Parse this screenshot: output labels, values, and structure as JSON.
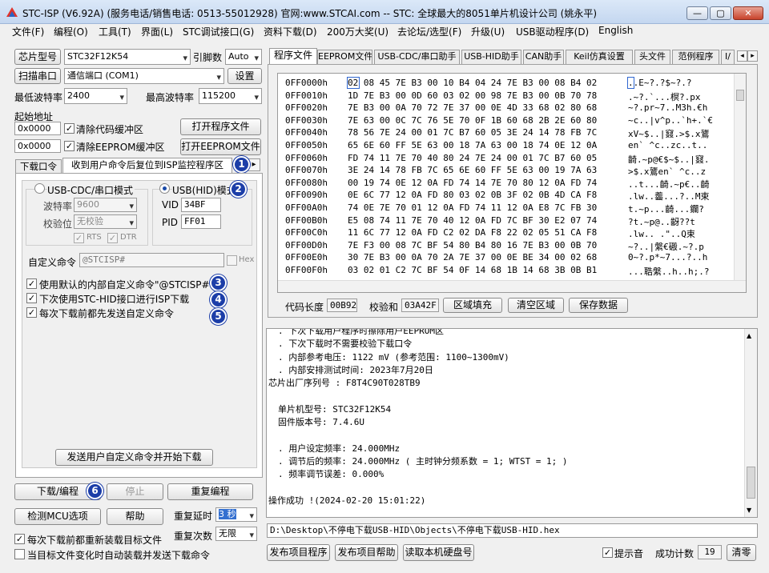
{
  "window": {
    "title": "STC-ISP (V6.92A) (服务电话/销售电话: 0513-55012928) 官网:www.STCAI.com  -- STC: 全球最大的8051单片机设计公司 (姚永平)",
    "min_label": "—",
    "max_label": "▢",
    "close_label": "✕"
  },
  "menu": [
    "文件(F)",
    "编程(O)",
    "工具(T)",
    "界面(L)",
    "STC调试接口(G)",
    "资料下载(D)",
    "200万大奖(U)",
    "去论坛/选型(F)",
    "升级(U)",
    "USB驱动程序(D)",
    "English"
  ],
  "left": {
    "chip_btn": "芯片型号",
    "chip_value": "STC32F12K54",
    "pin_label": "引脚数",
    "pin_value": "Auto",
    "scan_btn": "扫描串口",
    "port_value": "通信端口 (COM1)",
    "settings_btn": "设置",
    "min_baud_label": "最低波特率",
    "min_baud_value": "2400",
    "max_baud_label": "最高波特率",
    "max_baud_value": "115200",
    "start_addr_label": "起始地址",
    "addr1": "0x0000",
    "clear_code_label": "清除代码缓冲区",
    "open_prog_btn": "打开程序文件",
    "addr2": "0x0000",
    "clear_eeprom_label": "清除EEPROM缓冲区",
    "open_eeprom_btn": "打开EEPROM文件",
    "tab_download": "下载口令",
    "tab_reset": "收到用户命令后复位到ISP监控程序区",
    "usb_cdc_label": "USB-CDC/串口模式",
    "usb_hid_label": "USB(HID)模式",
    "baud_label": "波特率",
    "baud_value": "9600",
    "parity_label": "校验位",
    "parity_value": "无校验",
    "rts_label": "RTS",
    "dtr_label": "DTR",
    "vid_label": "VID",
    "vid_value": "34BF",
    "pid_label": "PID",
    "pid_value": "FF01",
    "custom_cmd_label": "自定义命令",
    "custom_cmd_value": "@STCISP#",
    "hex_label": "Hex",
    "opt1": "使用默认的内部自定义命令\"@STCISP#\"",
    "opt2": "下次使用STC-HID接口进行ISP下载",
    "opt3": "每次下载前都先发送自定义命令",
    "send_btn": "发送用户自定义命令并开始下载",
    "download_btn": "下载/编程",
    "stop_btn": "停止",
    "reprogram_btn": "重复编程",
    "detect_btn": "检测MCU选项",
    "help_btn": "帮助",
    "repeat_delay_label": "重复延时",
    "repeat_delay_value": "3 秒",
    "repeat_count_label": "重复次数",
    "repeat_count_value": "无限",
    "reload_label": "每次下载前都重新装载目标文件",
    "auto_label": "当目标文件变化时自动装载并发送下载命令",
    "badges": [
      "1",
      "2",
      "3",
      "4",
      "5",
      "6"
    ]
  },
  "right": {
    "tabs": [
      "程序文件",
      "EEPROM文件",
      "USB-CDC/串口助手",
      "USB-HID助手",
      "CAN助手",
      "Keil仿真设置",
      "头文件",
      "范例程序",
      "I/"
    ],
    "hex_rows": [
      {
        "addr": "0FF0000h",
        "bytes": "02 08 45 7E B3 00 10 B4 04 24 7E B3 00 08 B4 02",
        "ascii": "..E~?.?$~?.?"
      },
      {
        "addr": "0FF0010h",
        "bytes": "1D 7E B3 00 0D 60 03 02 00 98 7E B3 00 0B 70 78",
        "ascii": ".~?.`...榠?.px"
      },
      {
        "addr": "0FF0020h",
        "bytes": "7E B3 00 0A 70 72 7E 37 00 0E 4D 33 68 02 80 68",
        "ascii": "~?.pr~7..M3h.€h"
      },
      {
        "addr": "0FF0030h",
        "bytes": "7E 63 00 0C 7C 76 5E 70 0F 1B 60 68 2B 2E 60 80",
        "ascii": "~c..|v^p..`h+.`€"
      },
      {
        "addr": "0FF0040h",
        "bytes": "78 56 7E 24 00 01 7C B7 60 05 3E 24 14 78 FB 7C",
        "ascii": "xV~$..|窡.>$.x鷟"
      },
      {
        "addr": "0FF0050h",
        "bytes": "65 6E 60 FF 5E 63 00 18 7A 63 00 18 74 0E 12 0A",
        "ascii": "en` ^c..zc..t.."
      },
      {
        "addr": "0FF0060h",
        "bytes": "FD 74 11 7E 70 40 80 24 7E 24 00 01 7C B7 60 05",
        "ascii": "齮.~p@€$~$..|窡."
      },
      {
        "addr": "0FF0070h",
        "bytes": "3E 24 14 78 FB 7C 65 6E 60 FF 5E 63 00 19 7A 63",
        "ascii": ">$.x鷟en` ^c..z"
      },
      {
        "addr": "0FF0080h",
        "bytes": "00 19 74 0E 12 0A FD 74 14 7E 70 80 12 0A FD 74",
        "ascii": "..t...齮.~p€..齮"
      },
      {
        "addr": "0FF0090h",
        "bytes": "0E 6C 77 12 0A FD 80 03 02 0B 3F 02 0B 4D CA F8",
        "ascii": ".lw..齹...?..M束"
      },
      {
        "addr": "0FF00A0h",
        "bytes": "74 0E 7E 70 01 12 0A FD 74 11 12 0A E8 7C FB 30",
        "ascii": "t.~p...齮...鑭?"
      },
      {
        "addr": "0FF00B0h",
        "bytes": "E5 08 74 11 7E 70 40 12 0A FD 7C BF 30 E2 07 74",
        "ascii": "?t.~p@..齖??t"
      },
      {
        "addr": "0FF00C0h",
        "bytes": "11 6C 77 12 0A FD C2 02 DA F8 22 02 05 51 CA F8",
        "ascii": ".lw..  .\"..Q束"
      },
      {
        "addr": "0FF00D0h",
        "bytes": "7E F3 00 08 7C BF 54 80 B4 80 16 7E B3 00 0B 70",
        "ascii": "~?..|縏€磤.~?.p"
      },
      {
        "addr": "0FF00E0h",
        "bytes": "30 7E B3 00 0A 70 2A 7E 37 00 0E BE 34 00 02 68",
        "ascii": "0~?.p*~7...?..h"
      },
      {
        "addr": "0FF00F0h",
        "bytes": "03 02 01 C2 7C BF 54 0F 14 68 1B 14 68 3B 0B B1",
        "ascii": "...聕縏..h..h;.?"
      }
    ],
    "first_byte": "02",
    "code_len_label": "代码长度",
    "code_len_value": "00B92",
    "checksum_label": "校验和",
    "checksum_value": "03A42F",
    "fill_btn": "区域填充",
    "clear_btn": "清空区域",
    "save_btn": "保存数据",
    "log_lines": [
      ". 下次下载用户程序时擦除用户EEPROM区",
      ". 下次下载时不需要校验下载口令",
      ". 内部参考电压: 1122 mV (参考范围: 1100~1300mV)",
      ". 内部安排测试时间: 2023年7月20日",
      "芯片出厂序列号 : F8T4C90T028TB9",
      "",
      "单片机型号: STC32F12K54",
      "固件版本号: 7.4.6U",
      "",
      ". 用户设定频率: 24.000MHz",
      ". 调节后的频率: 24.000MHz ( 主时钟分频系数 = 1;  WTST = 1; )",
      ". 频率调节误差: 0.000%",
      "",
      "操作成功 !(2024-02-20 15:01:22)"
    ],
    "path": "D:\\Desktop\\不停电下载USB-HID\\Objects\\不停电下载USB-HID.hex",
    "publish_prog_btn": "发布项目程序",
    "publish_help_btn": "发布项目帮助",
    "read_disk_btn": "读取本机硬盘号",
    "sound_label": "提示音",
    "success_label": "成功计数",
    "success_value": "19",
    "clear_count_btn": "清零"
  }
}
